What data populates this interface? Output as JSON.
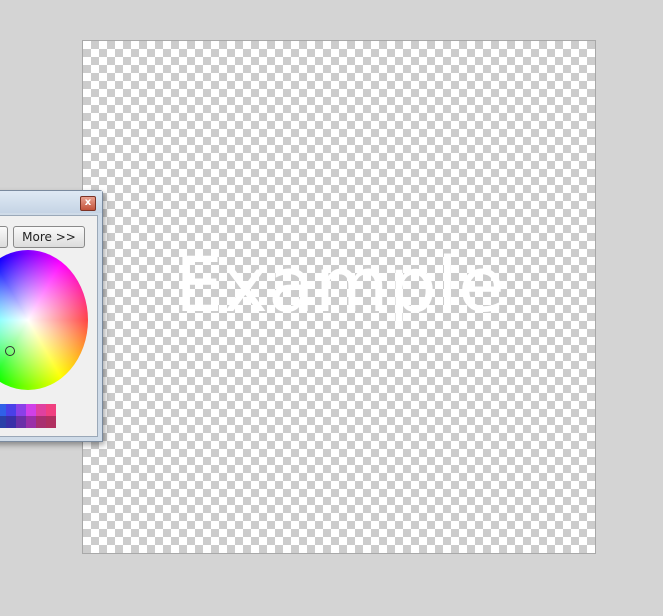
{
  "canvas": {
    "text": "Example",
    "text_color": "#ffffff"
  },
  "palette": {
    "close_label": "x",
    "more_button_label": "More >>",
    "swatches_top": [
      "#40c8e0",
      "#3aa0e8",
      "#3060e8",
      "#4a40e8",
      "#8a40e8",
      "#d040e8",
      "#e040a0",
      "#f04080"
    ],
    "swatches_bottom": [
      "#2a8aa0",
      "#2a6aa8",
      "#2a40a8",
      "#3a30a8",
      "#6a30a8",
      "#9a30a8",
      "#a83070",
      "#b03060"
    ]
  }
}
